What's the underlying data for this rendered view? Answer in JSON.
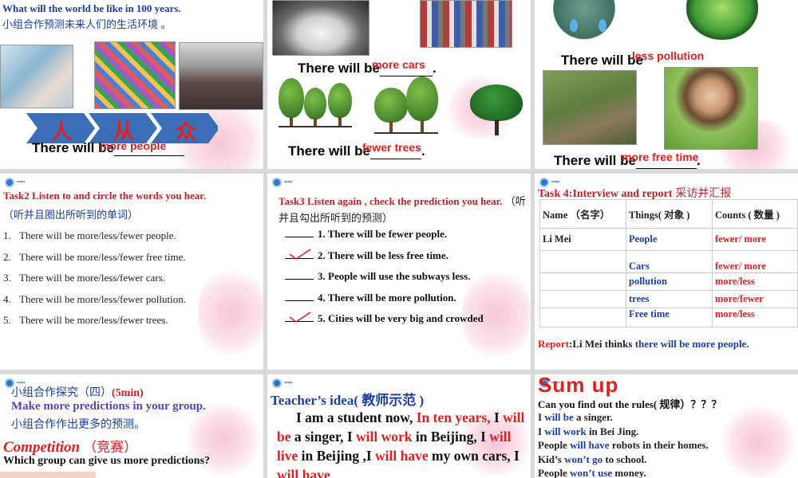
{
  "s1": {
    "top_text": "What will the world be like in 100 years.",
    "sub": "小组合作预测未来人们的生活环境 。",
    "arrows": [
      "人",
      "从",
      "众"
    ],
    "sentence": "There will be",
    "answer": "more people"
  },
  "s2": {
    "sentence1": "There will be",
    "answer1": "more cars",
    "sentence2": "There will be",
    "answer2": "fewer trees"
  },
  "s3": {
    "sentence1": "There will be",
    "answer1": "less pollution",
    "sentence2": "There will be",
    "answer2": "more free time"
  },
  "s4": {
    "title": "Task2  Listen to and circle the words you hear.",
    "sub": "（听并且圈出所听到的单词）",
    "items": [
      "There will be more/less/fewer people.",
      "There will be more/less/fewer free time.",
      "There will be more/less/fewer cars.",
      "There will be more/less/fewer pollution.",
      "There will be more/less/fewer trees."
    ],
    "nums": [
      "1.",
      "2.",
      "3.",
      "4.",
      "5."
    ]
  },
  "s5": {
    "title": "Task3  Listen again , check the prediction you hear.",
    "title_sub": "（听并且勾出所听到的预测）",
    "items": [
      "1. There will be fewer people.",
      "2. There will be less free time.",
      "3. People will use the subways less.",
      "4. There will be more pollution.",
      "5. Cities will be very big and crowded"
    ]
  },
  "s6": {
    "title": "Task 4:Interview and report",
    "title_cn": "采访并汇报",
    "headers": [
      "Name （名字）",
      "Things( 对象 )",
      "Counts ( 数量 )"
    ],
    "rows": [
      [
        "Li Mei",
        "People",
        "fewer/ more"
      ],
      [
        "",
        "Cars",
        "fewer/ more"
      ],
      [
        "",
        "pollution",
        "more/less"
      ],
      [
        "",
        "trees",
        "more/fewer"
      ],
      [
        "",
        "Free time",
        "more/less"
      ]
    ],
    "report_label": "Report",
    "report_mid": ":Li Mei thinks ",
    "report_blue": "there will be more people."
  },
  "s7": {
    "line1_cn": "小组合作探究（四）",
    "line1_time": "(5min)",
    "line2": "Make more predictions in your group.",
    "line3": "小组合作作出更多的预测。",
    "comp": "Competition",
    "comp_cn": "（竞赛）",
    "question": "Which group can give us more predictions?"
  },
  "s8": {
    "title": "Teacher’s idea( 教师示范 )",
    "p1": "I am a student now, ",
    "p1r": "In ten years,",
    "p2": " I ",
    "p2r": "will be",
    "p3": " a singer, I ",
    "p3r": "will work",
    "p4": " in Beijing, I ",
    "p4r": "will live",
    "p5": " in Beijing ,I ",
    "p5r": "will have",
    "p6": " my own cars, I ",
    "p6r": "will have"
  },
  "s9": {
    "title": "Sum up",
    "q": "Can you find out the rules( 规律）？？？",
    "lines": [
      {
        "a": "I ",
        "b": "will be",
        "c": " a singer."
      },
      {
        "a": "I ",
        "b": "will work",
        "c": " in Bei Jing."
      },
      {
        "a": "People ",
        "b": "will have",
        "c": " robots in their homes."
      },
      {
        "a": "Kid’s ",
        "b": "won’t go",
        "c": " to school."
      },
      {
        "a": "People ",
        "b": "won’t use",
        "c": " money."
      }
    ]
  },
  "colors": {
    "red": "#e02020",
    "blue": "#1b3ea3",
    "arrow": "#3a6fb8"
  }
}
